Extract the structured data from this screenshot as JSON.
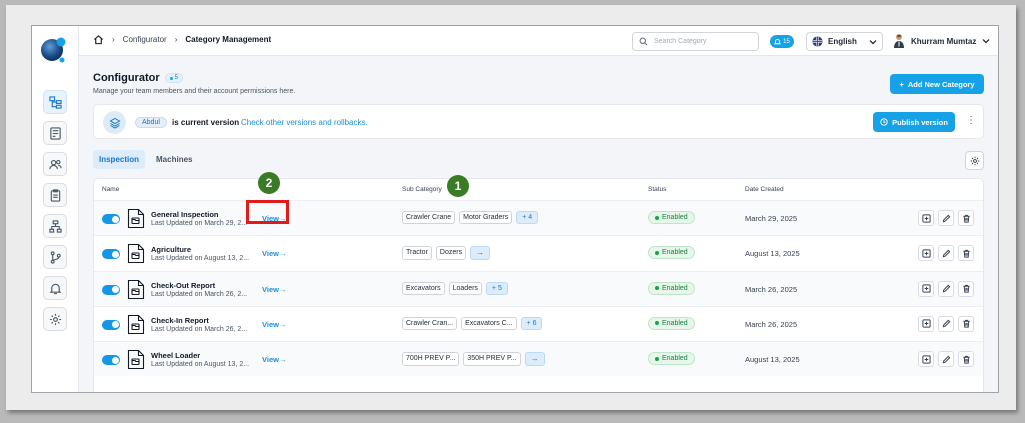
{
  "header": {
    "breadcrumb": [
      "Configurator",
      "Category Management"
    ],
    "search_placeholder": "Search Category",
    "notification_count": "15",
    "language": "English",
    "user_name": "Khurram Mumtaz"
  },
  "page": {
    "title": "Configurator",
    "count_badge": "5",
    "subtitle": "Manage your team members and their account permissions here.",
    "add_button": "Add New Category"
  },
  "version": {
    "user_tag": "Abdul",
    "status_text": "is current version",
    "link_text": "Check other versions and rollbacks.",
    "publish_button": "Publish version"
  },
  "tabs": [
    {
      "label": "Inspection",
      "active": true
    },
    {
      "label": "Machines",
      "active": false
    }
  ],
  "table": {
    "columns": [
      "Name",
      "Sub Category",
      "Status",
      "Date Created"
    ],
    "view_label": "View",
    "rows": [
      {
        "name": "General Inspection",
        "updated": "Last Updated on March 29, 2...",
        "chips": [
          "Crawler Crane",
          "Motor Graders"
        ],
        "more": "+ 4",
        "status": "Enabled",
        "date": "March 29, 2025"
      },
      {
        "name": "Agriculture",
        "updated": "Last Updated on August 13, 2...",
        "chips": [
          "Tractor",
          "Dozers"
        ],
        "more": "",
        "status": "Enabled",
        "date": "August 13, 2025"
      },
      {
        "name": "Check-Out Report",
        "updated": "Last Updated on March 26, 2...",
        "chips": [
          "Excavators",
          "Loaders"
        ],
        "more": "+ 5",
        "status": "Enabled",
        "date": "March 26, 2025"
      },
      {
        "name": "Check-In Report",
        "updated": "Last Updated on March 26, 2...",
        "chips": [
          "Crawler Cran...",
          "Excavators C..."
        ],
        "more": "+ 6",
        "status": "Enabled",
        "date": "March 26, 2025"
      },
      {
        "name": "Wheel Loader",
        "updated": "Last Updated on August 13, 2...",
        "chips": [
          "700H PREV P...",
          "350H PREV P..."
        ],
        "more": "",
        "status": "Enabled",
        "date": "August 13, 2025"
      }
    ]
  },
  "annotations": {
    "callout_1": "1",
    "callout_2": "2"
  },
  "colors": {
    "accent": "#17a2e8",
    "enabled": "#16a34a",
    "annotation_green": "#3a7b26",
    "highlight_red": "#e11a1a"
  }
}
